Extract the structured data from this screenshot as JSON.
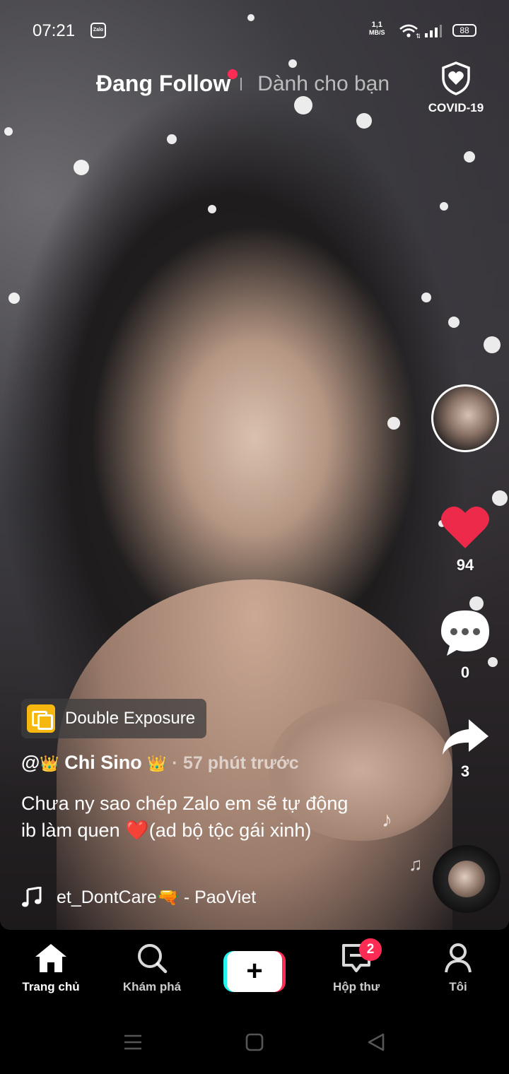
{
  "status_bar": {
    "time": "07:21",
    "notification_app": "Zalo",
    "net_speed_value": "1,1",
    "net_speed_unit": "MB/S",
    "battery": "88"
  },
  "top_tabs": {
    "following": "Đang Follow",
    "for_you": "Dành cho bạn",
    "covid_label": "COVID-19"
  },
  "rail": {
    "likes": "94",
    "comments": "0",
    "shares": "3"
  },
  "effect": {
    "label": "Double Exposure"
  },
  "post": {
    "at": "@",
    "crown_left": "👑",
    "author": "Chi Sino",
    "crown_right": "👑",
    "separator": "·",
    "time_ago": "57 phút trước",
    "caption_part1": "Chưa ny sao chép Zalo em sẽ tự động ib làm quen ",
    "caption_heart": "❤️",
    "caption_part2": "(ad bộ tộc gái xinh)"
  },
  "music": {
    "title": "et_DontCare🔫 - PaoViet"
  },
  "bottom_nav": {
    "home": "Trang chủ",
    "discover": "Khám phá",
    "create": "+",
    "inbox": "Hộp thư",
    "inbox_badge": "2",
    "profile": "Tôi"
  },
  "colors": {
    "accent_red": "#fe2c55",
    "accent_cyan": "#25f4ee",
    "like_red": "#ee2a4a",
    "effect_yellow": "#f6b70e"
  }
}
